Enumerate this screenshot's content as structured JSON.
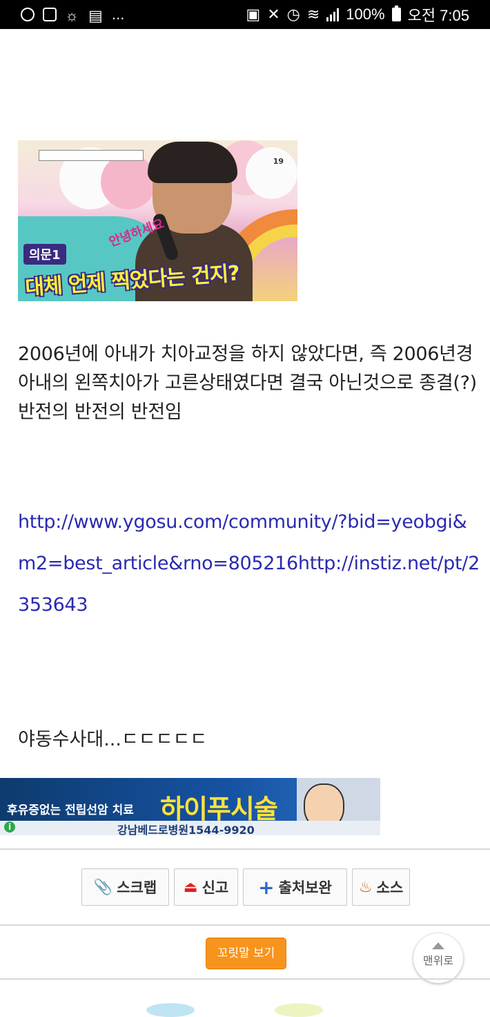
{
  "status_bar": {
    "overflow": "...",
    "battery": "100%",
    "time": "오전 7:05"
  },
  "image_captions": {
    "label": "의문1",
    "headline": "대체 언제 찍었다는 건지?",
    "greeting": "안녕하세요",
    "badge": "19"
  },
  "article": {
    "paragraph": "2006년에 아내가 치아교정을 하지 않았다면, 즉 2006년경 아내의 왼쪽치아가 고른상태였다면 결국 아닌것으로 종결(?) 반전의 반전의 반전임",
    "link": "http://www.ygosu.com/community/?bid=yeobgi&m2=best_article&rno=805216http://instiz.net/pt/2353643",
    "closing": "야동수사대...ㄷㄷㄷㄷㄷ"
  },
  "ad": {
    "small_text": "후유증없는 전립선암 치료",
    "big_text": "하이푸시술",
    "hospital": "강남베드로병원1544-9920"
  },
  "actions": {
    "scrap": "스크랩",
    "report": "신고",
    "source_complement": "출처보완",
    "source": "소스"
  },
  "comments_button": "꼬릿말 보기",
  "to_top": "맨위로",
  "icons": {
    "scrap": "paperclip-icon",
    "report": "stamp-icon",
    "source_complement": "plus-icon",
    "source": "bottle-icon"
  }
}
